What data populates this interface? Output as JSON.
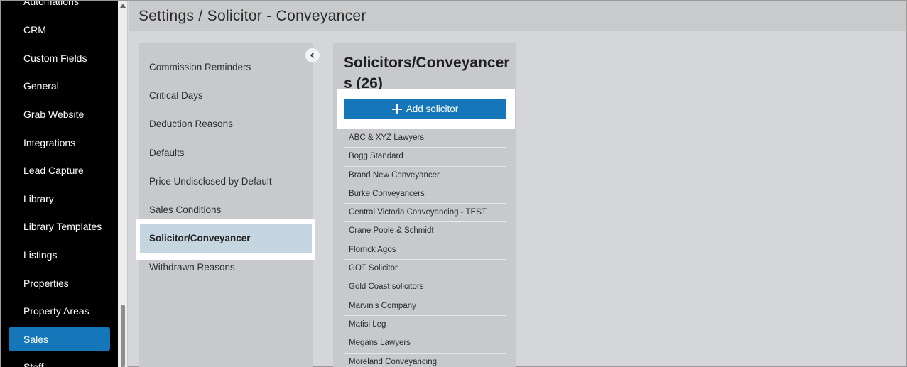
{
  "header": {
    "title": "Settings / Solicitor - Conveyancer"
  },
  "sidebar": {
    "items": [
      {
        "label": "Automations"
      },
      {
        "label": "CRM"
      },
      {
        "label": "Custom Fields"
      },
      {
        "label": "General"
      },
      {
        "label": "Grab Website"
      },
      {
        "label": "Integrations"
      },
      {
        "label": "Lead Capture"
      },
      {
        "label": "Library"
      },
      {
        "label": "Library Templates"
      },
      {
        "label": "Listings"
      },
      {
        "label": "Properties"
      },
      {
        "label": "Property Areas"
      },
      {
        "label": "Sales"
      },
      {
        "label": "Staff"
      }
    ],
    "active": "Sales"
  },
  "categories": {
    "items": [
      {
        "label": "Commission Reminders"
      },
      {
        "label": "Critical Days"
      },
      {
        "label": "Deduction Reasons"
      },
      {
        "label": "Defaults"
      },
      {
        "label": "Price Undisclosed by Default"
      },
      {
        "label": "Sales Conditions"
      },
      {
        "label": "Solicitor/Conveyancer"
      },
      {
        "label": "Withdrawn Reasons"
      }
    ],
    "active": "Solicitor/Conveyancer"
  },
  "solicitors": {
    "title": "Solicitors/Conveyancers (26)",
    "add_label": "Add solicitor",
    "items": [
      "ABC & XYZ Lawyers",
      "Bogg Standard",
      "Brand New Conveyancer",
      "Burke Conveyancers",
      "Central Victoria Conveyancing - TEST",
      "Crane Poole & Schmidt",
      "Florrick Agos",
      "GOT Solicitor",
      "Gold Coast solicitors",
      "Marvin's Company",
      "Matisi Leg",
      "Megans Lawyers",
      "Moreland Conveyancing"
    ]
  },
  "colors": {
    "accent": "#1577b9",
    "sidebar_bg": "#000000",
    "active_category_bg": "#c5d6e1"
  },
  "icons": {
    "collapse": "chevron-left-icon",
    "add": "plus-icon"
  }
}
